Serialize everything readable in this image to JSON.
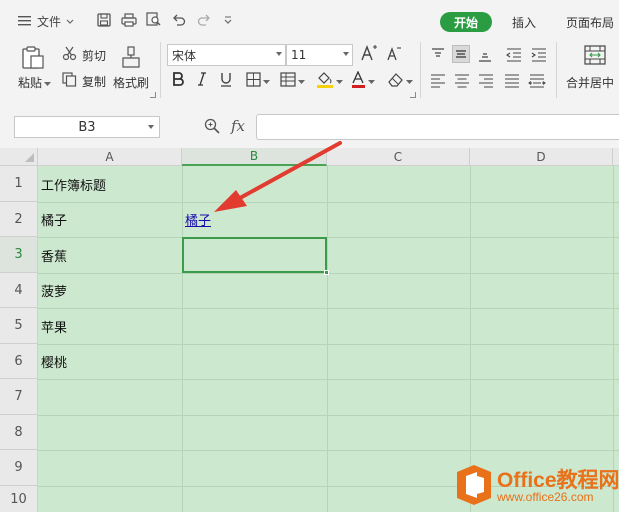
{
  "titlebar": {
    "file_menu": "文件",
    "tabs": {
      "start": "开始",
      "insert": "插入",
      "page_layout": "页面布局"
    }
  },
  "ribbon": {
    "paste": "粘贴",
    "cut": "剪切",
    "copy": "复制",
    "format_painter": "格式刷",
    "font_name": "宋体",
    "font_size": "11",
    "merge_center": "合并居中"
  },
  "formula_bar": {
    "name_box": "B3",
    "fx_label": "fx",
    "formula": ""
  },
  "sheet": {
    "columns": [
      "A",
      "B",
      "C",
      "D"
    ],
    "rows": [
      "1",
      "2",
      "3",
      "4",
      "5",
      "6",
      "7",
      "8",
      "9",
      "10"
    ],
    "cells": {
      "A1": "工作簿标题",
      "A2": "橘子",
      "B2": "橘子",
      "A3": "香蕉",
      "A4": "菠萝",
      "A5": "苹果",
      "A6": "樱桃"
    },
    "selected_cell": "B3"
  },
  "watermark": {
    "title": "Office教程网",
    "url": "www.office26.com"
  },
  "colors": {
    "accent": "#2a9d43",
    "sheet_bg": "#cce8cf",
    "arrow": "#e23b30",
    "link": "#1a0dab",
    "watermark": "#e8711a"
  }
}
